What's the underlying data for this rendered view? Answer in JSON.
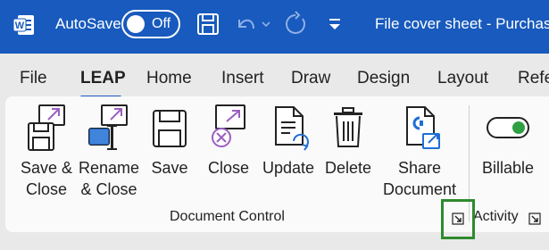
{
  "titlebar": {
    "autosave_label": "AutoSave",
    "autosave_state": "Off",
    "document_title": "File cover sheet - Purchas",
    "app_icon": "word-logo-icon",
    "quick_access_icons": [
      "save-icon",
      "undo-icon",
      "undo-dropdown-icon",
      "redo-icon",
      "customize-dropdown-icon"
    ],
    "colors": {
      "background": "#185abd"
    }
  },
  "tabs": [
    {
      "label": "File"
    },
    {
      "label": "LEAP",
      "active": true
    },
    {
      "label": "Home"
    },
    {
      "label": "Insert"
    },
    {
      "label": "Draw"
    },
    {
      "label": "Design"
    },
    {
      "label": "Layout"
    },
    {
      "label": "Refe"
    }
  ],
  "ribbon": {
    "groups": [
      {
        "label": "Document Control",
        "buttons": [
          {
            "label": "Save &\nClose",
            "icon": "save-close-icon"
          },
          {
            "label": "Rename\n& Close",
            "icon": "rename-close-icon"
          },
          {
            "label": "Save",
            "icon": "floppy-disk-icon"
          },
          {
            "label": "Close",
            "icon": "close-document-icon"
          },
          {
            "label": "Update",
            "icon": "update-document-icon"
          },
          {
            "label": "Delete",
            "icon": "trash-icon"
          },
          {
            "label": "Share\nDocument",
            "icon": "share-document-icon"
          }
        ]
      },
      {
        "label": "Activity",
        "buttons": [
          {
            "label": "Billable",
            "icon": "billable-toggle-icon",
            "toggle_on": true
          }
        ]
      }
    ],
    "colors": {
      "accent_purple": "#9b5fc0",
      "toggle_green": "#2ea043",
      "highlight_green": "#2f8a2f"
    }
  }
}
